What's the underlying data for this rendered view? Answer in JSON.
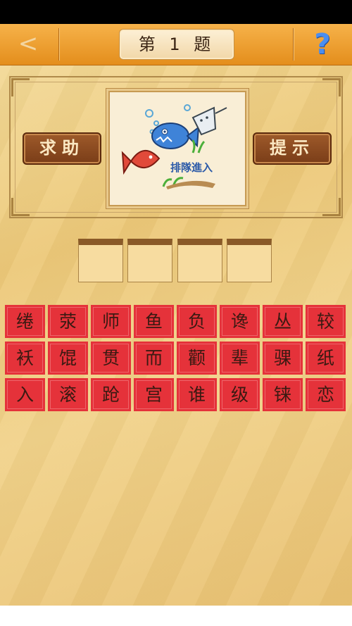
{
  "header": {
    "back_glyph": "<",
    "title": "第 1 题",
    "help_glyph": "?"
  },
  "buttons": {
    "help_label": "求助",
    "hint_label": "提示"
  },
  "puzzle": {
    "caption": "排隊進入"
  },
  "answer": {
    "slots": [
      "",
      "",
      "",
      ""
    ]
  },
  "tiles": [
    [
      "绻",
      "荥",
      "师",
      "鱼",
      "负",
      "谗",
      "丛",
      "较"
    ],
    [
      "袄",
      "馄",
      "贯",
      "而",
      "颧",
      "辈",
      "骒",
      "纸"
    ],
    [
      "入",
      "滚",
      "跄",
      "宫",
      "谁",
      "级",
      "铼",
      "恋"
    ]
  ],
  "colors": {
    "nav_orange": "#e48e1c",
    "tile_red": "#e5323a",
    "help_blue": "#4a8ef0",
    "wood_brown": "#7a3d18"
  }
}
